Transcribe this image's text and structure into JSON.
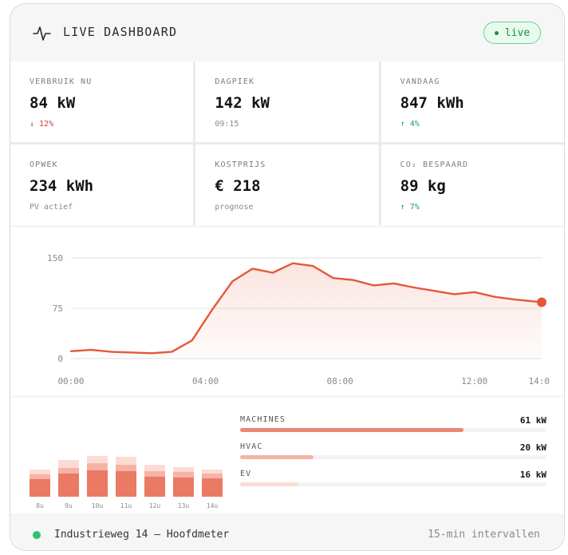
{
  "header": {
    "title": "LIVE DASHBOARD",
    "icon": "pulse-icon",
    "live_label": "live"
  },
  "colors": {
    "accent": "#e4583a",
    "live": "#1f8f45",
    "down": "#d63b3b",
    "up": "#23a05a"
  },
  "stats": [
    {
      "label": "VERBRUIK NU",
      "value": "84 kW",
      "sub": "↓ 12%",
      "trend": "down"
    },
    {
      "label": "DAGPIEK",
      "value": "142 kW",
      "sub": "09:15",
      "trend": "neutral"
    },
    {
      "label": "VANDAAG",
      "value": "847 kWh",
      "sub": "↑ 4%",
      "trend": "up"
    },
    {
      "label": "OPWEK",
      "value": "234 kWh",
      "sub": "PV actief",
      "trend": "neutral"
    },
    {
      "label": "KOSTPRIJS",
      "value": "€ 218",
      "sub": "prognose",
      "trend": "neutral"
    },
    {
      "label": "CO₂ BESPAARD",
      "value": "89 kg",
      "sub": "↑ 7%",
      "trend": "up"
    }
  ],
  "chart_data": {
    "type": "area",
    "title": "",
    "xlabel": "",
    "ylabel": "",
    "x_tick_labels": [
      "00:00",
      "04:00",
      "08:00",
      "12:00",
      "14:0"
    ],
    "y_tick_labels": [
      "150",
      "75",
      "0"
    ],
    "ylim": [
      0,
      150
    ],
    "xlim": [
      0,
      14
    ],
    "grid": true,
    "series": [
      {
        "x": [
          0,
          0.6,
          1.2,
          1.8,
          2.4,
          3.0,
          3.6,
          4.2,
          4.8,
          5.4,
          6.0,
          6.6,
          7.2,
          7.8,
          8.4,
          9.0,
          9.6,
          10.2,
          10.8,
          11.4,
          12.0,
          12.6,
          13.2,
          13.8,
          14.0
        ],
        "y": [
          11,
          13,
          10,
          9,
          8,
          10,
          27,
          73,
          115,
          134,
          128,
          142,
          138,
          120,
          117,
          109,
          112,
          106,
          101,
          96,
          99,
          92,
          88,
          85,
          84
        ]
      }
    ]
  },
  "hourly_bars": {
    "labels": [
      "8u",
      "9u",
      "10u",
      "11u",
      "12u",
      "13u",
      "14u"
    ],
    "stacks": [
      [
        37,
        10,
        10
      ],
      [
        48,
        12,
        16
      ],
      [
        55,
        15,
        15
      ],
      [
        54,
        12,
        18
      ],
      [
        42,
        12,
        12
      ],
      [
        40,
        12,
        10
      ],
      [
        38,
        10,
        8
      ]
    ],
    "colors": [
      "#ea7a63",
      "#f5b3a6",
      "#fbdcd5"
    ]
  },
  "consumers": [
    {
      "label": "MACHINES",
      "value": "61 kW",
      "fraction": 0.73,
      "color": "#ea8672"
    },
    {
      "label": "HVAC",
      "value": "20 kW",
      "fraction": 0.24,
      "color": "#f3b4a6"
    },
    {
      "label": "EV",
      "value": "16 kW",
      "fraction": 0.19,
      "color": "#fadbd3"
    }
  ],
  "footer": {
    "location": "Industrieweg 14 — Hoofdmeter",
    "interval": "15-min intervallen"
  }
}
